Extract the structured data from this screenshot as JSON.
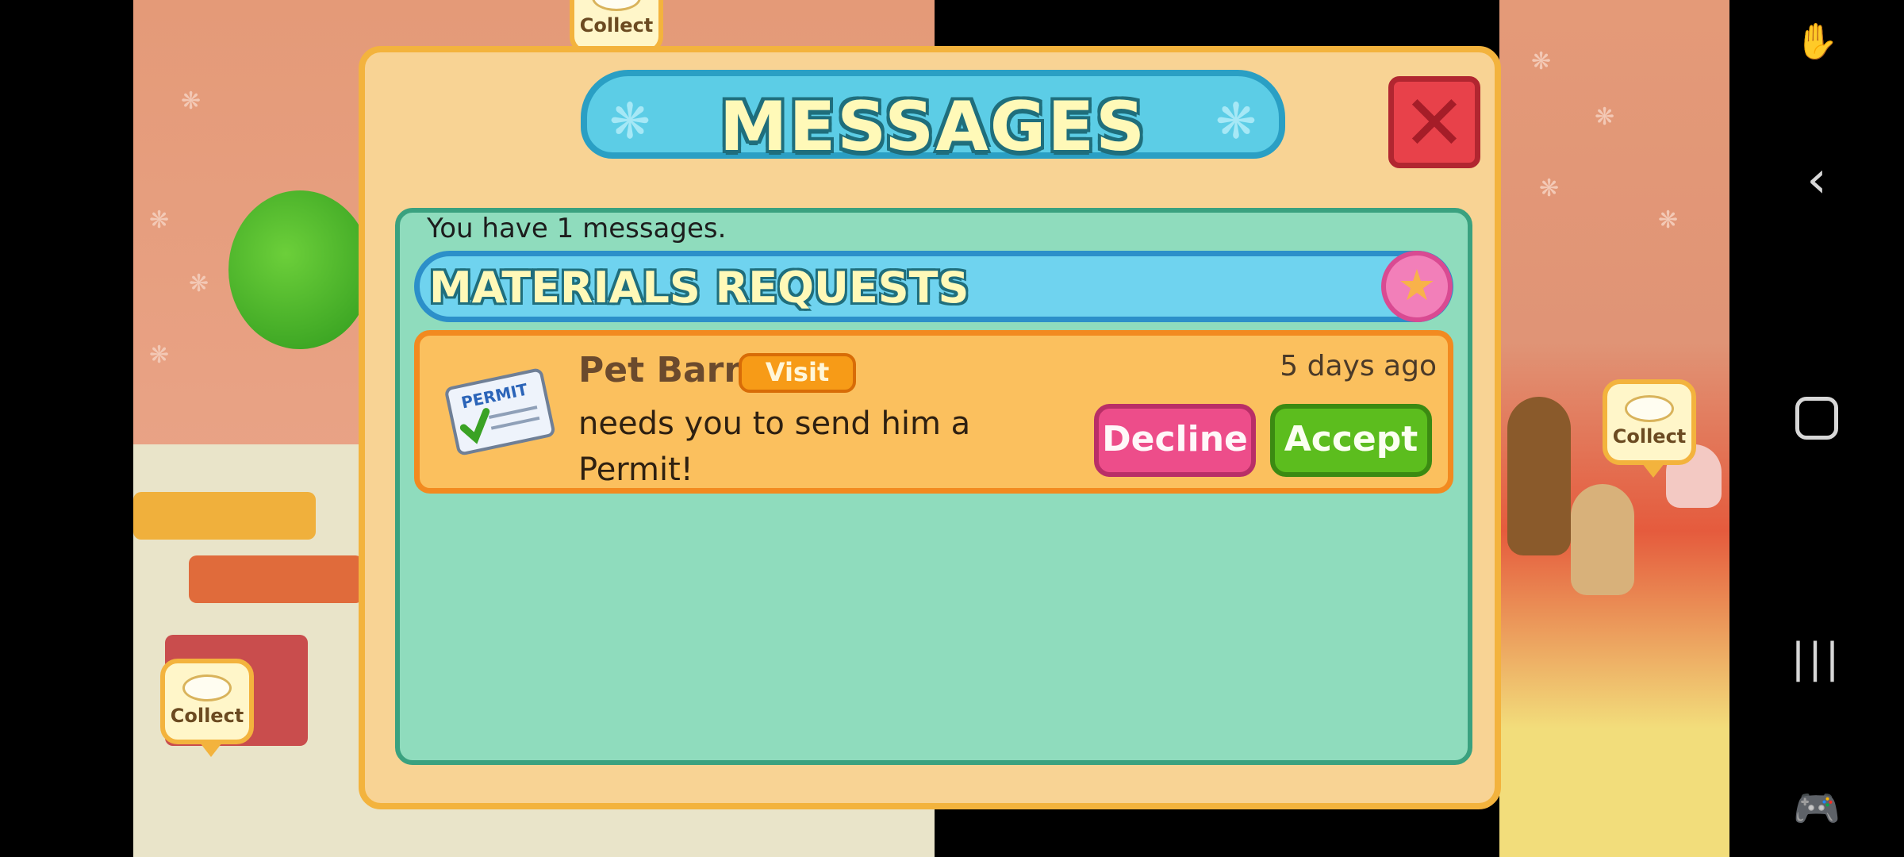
{
  "dialog": {
    "title": "MESSAGES",
    "message_count_text": "You have 1 messages.",
    "section_title": "MATERIALS REQUESTS",
    "messages": [
      {
        "sender": "Pet Barn",
        "visit_label": "Visit",
        "text": "needs you to send him a Permit!",
        "time": "5 days ago",
        "decline_label": "Decline",
        "accept_label": "Accept",
        "icon_label": "PERMIT"
      }
    ]
  },
  "scene": {
    "collect_label": "Collect"
  },
  "icons": [
    "close-icon",
    "star-icon",
    "permit-icon",
    "paw-icon",
    "back-icon",
    "home-icon",
    "recents-icon",
    "game-tools-icon",
    "accessibility-icon"
  ],
  "colors": {
    "dialog_bg": "#f8d394",
    "panel_bg": "#8fdcbd",
    "accept": "#5cbd1e",
    "decline": "#ed4d8a",
    "close": "#e8414a"
  }
}
